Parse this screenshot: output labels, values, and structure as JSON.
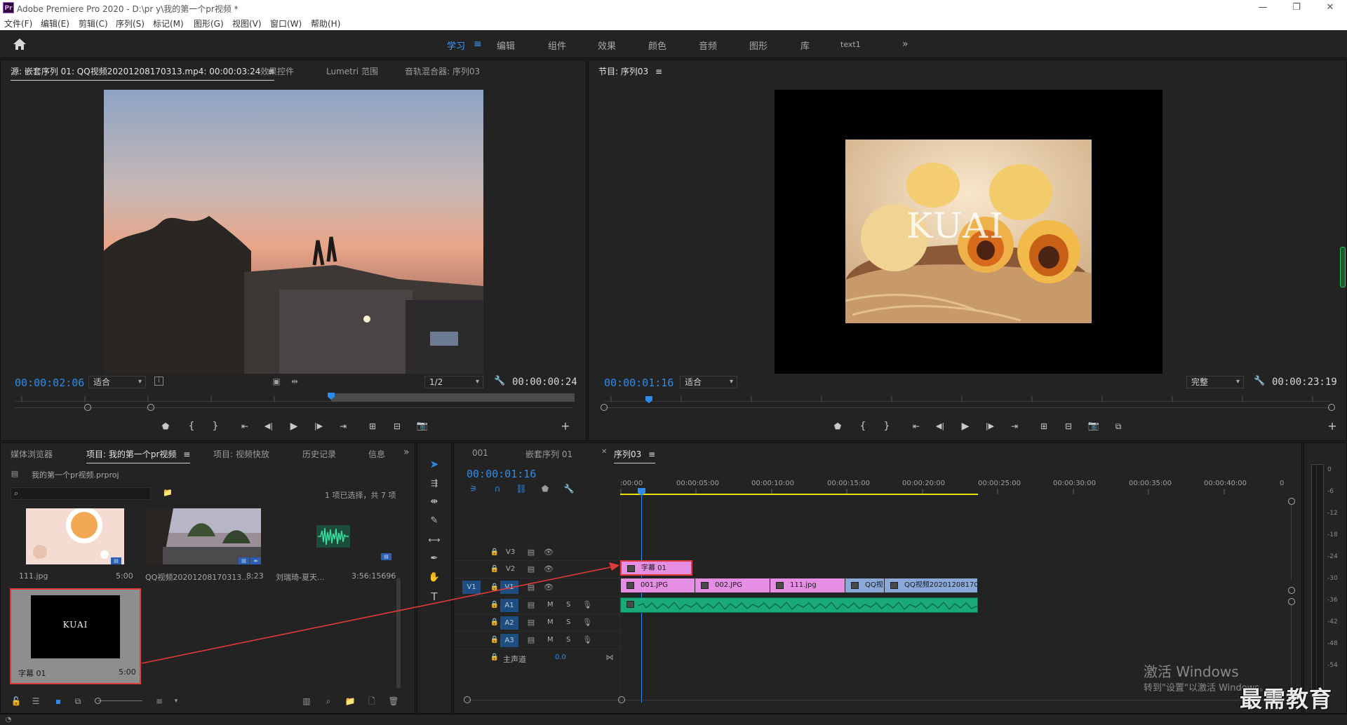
{
  "window": {
    "title": "Adobe Premiere Pro 2020 - D:\\pr y\\我的第一个pr视频 *",
    "logo_text": "Pr",
    "minimize": "—",
    "restore": "❐",
    "close": "✕"
  },
  "menu": [
    "文件(F)",
    "编辑(E)",
    "剪辑(C)",
    "序列(S)",
    "标记(M)",
    "图形(G)",
    "视图(V)",
    "窗口(W)",
    "帮助(H)"
  ],
  "workspaces": {
    "items": [
      "学习",
      "编辑",
      "组件",
      "效果",
      "颜色",
      "音频",
      "图形",
      "库",
      "text1"
    ],
    "active": "学习",
    "menu_icon": "≡",
    "overflow": "»"
  },
  "source_panel": {
    "tabs": [
      "源: 嵌套序列 01: QQ视频20201208170313.mp4: 00:00:03:24",
      "效果控件",
      "Lumetri 范围",
      "音轨混合器: 序列03"
    ],
    "timecode_current": "00:00:02:06",
    "fit": "适合",
    "resolution": "1/2",
    "timecode_duration": "00:00:00:24"
  },
  "program_panel": {
    "tab": "节目: 序列03",
    "timecode_current": "00:00:01:16",
    "fit": "适合",
    "quality": "完整",
    "timecode_duration": "00:00:23:19",
    "overlay_text": "KUAI"
  },
  "project_panel": {
    "tabs": [
      "媒体浏览器",
      "项目: 我的第一个pr视频",
      "项目: 视频快放",
      "历史记录",
      "信息"
    ],
    "project_file": "我的第一个pr视频.prproj",
    "selection_status": "1 项已选择，共 7 项",
    "items": [
      {
        "name": "111.jpg",
        "duration": "5:00"
      },
      {
        "name": "QQ视频20201208170313...",
        "duration": "8;23"
      },
      {
        "name": "刘瑞琦-夏天...",
        "duration": "3:56:15696"
      },
      {
        "name": "字幕 01",
        "duration": "5:00",
        "thumb_text": "KUAI"
      }
    ]
  },
  "timeline": {
    "tabs": [
      "001",
      "嵌套序列 01",
      "序列03"
    ],
    "timecode": "00:00:01:16",
    "ruler": [
      ":00:00",
      "00:00:05:00",
      "00:00:10:00",
      "00:00:15:00",
      "00:00:20:00",
      "00:00:25:00",
      "00:00:30:00",
      "00:00:35:00",
      "00:00:40:00",
      "0"
    ],
    "video_tracks": [
      "V3",
      "V2",
      "V1"
    ],
    "audio_tracks": [
      "A1",
      "A2",
      "A3"
    ],
    "source_patch": "V1",
    "master": {
      "label": "主声道",
      "value": "0.0"
    },
    "mute": "M",
    "solo": "S",
    "clips_v2": [
      {
        "name": "字幕 01"
      }
    ],
    "clips_v1": [
      {
        "name": "001.JPG"
      },
      {
        "name": "002.JPG"
      },
      {
        "name": "111.jpg"
      },
      {
        "name": "QQ视"
      },
      {
        "name": "QQ视频20201208170"
      }
    ]
  },
  "meter": {
    "labels": [
      "0",
      "-6",
      "-12",
      "-18",
      "-24",
      "-30",
      "-36",
      "-42",
      "-48",
      "-54"
    ]
  },
  "watermark": {
    "activate_title": "激活 Windows",
    "activate_sub": "转到\"设置\"以激活 Windows。",
    "brand": "最需教育"
  },
  "colors": {
    "accent": "#2d8ceb",
    "clip_pink": "#e58ee3",
    "clip_blue": "#8aa8d8",
    "audio_green": "#1aa97a",
    "annotation_red": "#e03a3a"
  }
}
